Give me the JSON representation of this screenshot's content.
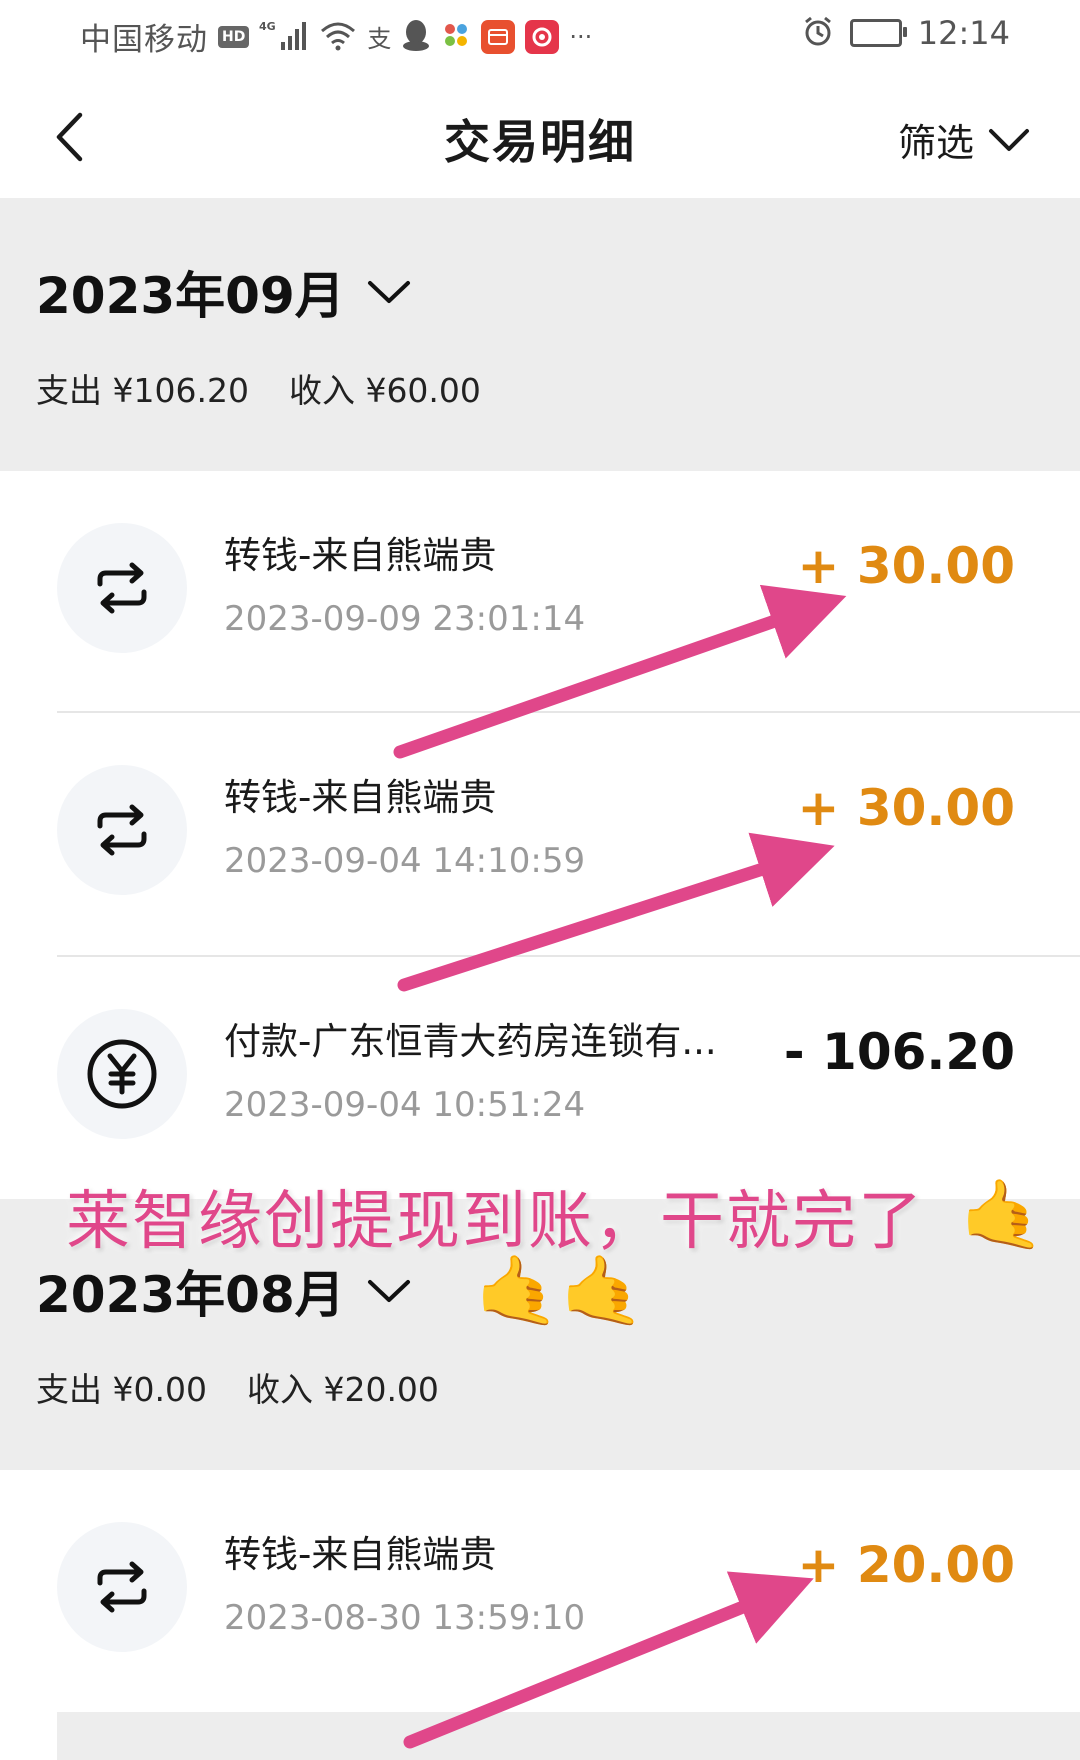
{
  "status_bar": {
    "carrier": "中国移动",
    "hd_badge": "HD",
    "network": "4G",
    "time": "12:14",
    "more": "···"
  },
  "header": {
    "title": "交易明细",
    "filter_label": "筛选"
  },
  "months": [
    {
      "label": "2023年09月",
      "expense_summary": "支出 ¥106.20",
      "income_summary": "收入 ¥60.00"
    },
    {
      "label": "2023年08月",
      "expense_summary": "支出 ¥0.00",
      "income_summary": "收入 ¥20.00"
    }
  ],
  "transactions": [
    {
      "title": "转钱-来自熊端贵",
      "time": "2023-09-09 23:01:14",
      "amount": "+ 30.00",
      "type": "income",
      "icon": "transfer-icon"
    },
    {
      "title": "转钱-来自熊端贵",
      "time": "2023-09-04 14:10:59",
      "amount": "+ 30.00",
      "type": "income",
      "icon": "transfer-icon"
    },
    {
      "title": "付款-广东恒青大药房连锁有...",
      "time": "2023-09-04 10:51:24",
      "amount": "- 106.20",
      "type": "expense",
      "icon": "yuan-icon"
    },
    {
      "title": "转钱-来自熊端贵",
      "time": "2023-08-30 13:59:10",
      "amount": "+ 20.00",
      "type": "income",
      "icon": "transfer-icon"
    }
  ],
  "overlay": {
    "promo_text": "莱智缘创提现到账，干就完了",
    "hand_emoji": "🤙",
    "arrow_color": "#e0478a"
  },
  "colors": {
    "income": "#e08a12",
    "expense": "#111111",
    "band": "#ededed"
  }
}
